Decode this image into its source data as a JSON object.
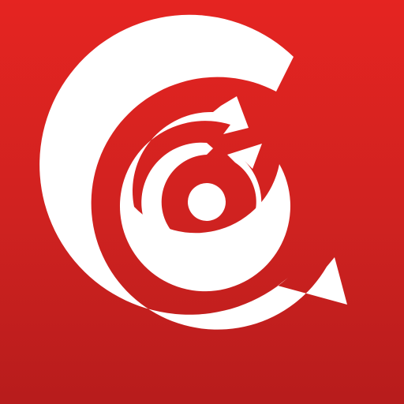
{
  "app_icon": {
    "icon": "concentric-circular-arrows-target-icon",
    "colors": {
      "background_top": "#e52421",
      "background_bottom": "#b71c1c",
      "foreground": "#ffffff"
    }
  }
}
